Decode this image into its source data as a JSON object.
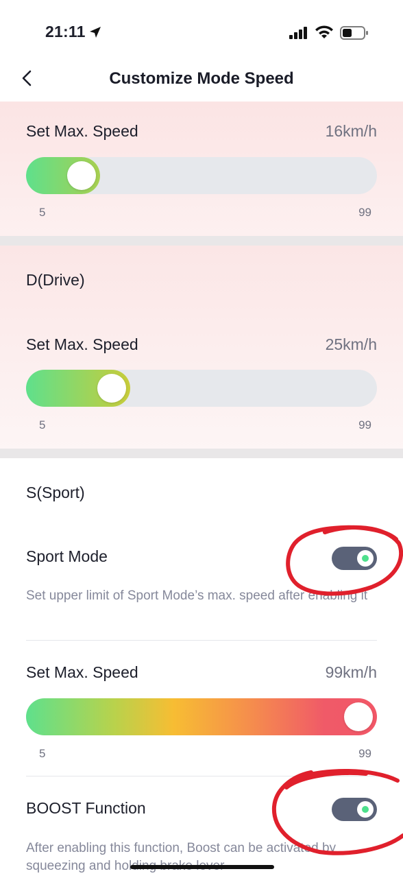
{
  "status_bar": {
    "time": "21:11"
  },
  "nav": {
    "title": "Customize Mode Speed"
  },
  "section1": {
    "label": "Set Max. Speed",
    "value": "16km/h",
    "min": "5",
    "max": "99",
    "level": 16
  },
  "section2": {
    "title": "D(Drive)",
    "label": "Set Max. Speed",
    "value": "25km/h",
    "min": "5",
    "max": "99",
    "level": 25
  },
  "section3": {
    "title": "S(Sport)",
    "sport_mode_label": "Sport Mode",
    "sport_mode_on": true,
    "sport_mode_desc": "Set upper limit of Sport Mode’s max. speed after enabling it",
    "speed_label": "Set Max. Speed",
    "speed_value": "99km/h",
    "min": "5",
    "max": "99",
    "level": 99,
    "boost_label": "BOOST Function",
    "boost_on": true,
    "boost_desc": "After enabling this function, Boost can be activated by squeezing and holding brake lever"
  },
  "colors": {
    "accent_green": "#4ee08c",
    "toggle_bg": "#5a6278",
    "annotation_red": "#e0202c"
  }
}
